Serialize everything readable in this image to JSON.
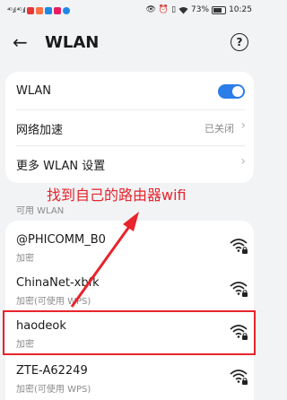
{
  "status_bar": {
    "signal_left": "⁴ᴳ.ıl ⁴ᴳ.ıl",
    "battery_percent": "73%",
    "time": "10:25",
    "app_icon_colors": [
      "#e53935",
      "#ff7043",
      "#1e88e5",
      "#e91e63",
      "#1e88e5"
    ]
  },
  "header": {
    "back_icon": "←",
    "title": "WLAN",
    "help_icon": "?"
  },
  "settings": {
    "wlan_label": "WLAN",
    "wlan_enabled": true,
    "accel_label": "网络加速",
    "accel_value": "已关闭",
    "more_label": "更多 WLAN 设置",
    "chevron": "›"
  },
  "annotation": {
    "text": "找到自己的路由器wifi",
    "color": "#e8242c"
  },
  "available": {
    "section_label": "可用 WLAN",
    "networks": [
      {
        "name": "@PHICOMM_B0",
        "security": "加密"
      },
      {
        "name": "ChinaNet-xbfk",
        "security": "加密(可使用 WPS)"
      },
      {
        "name": "haodeok",
        "security": "加密"
      },
      {
        "name": "ZTE-A62249",
        "security": "加密(可使用 WPS)"
      }
    ]
  },
  "colors": {
    "accent": "#2b7de9",
    "annotation_red": "#e8242c",
    "background": "#f1f3f5"
  }
}
